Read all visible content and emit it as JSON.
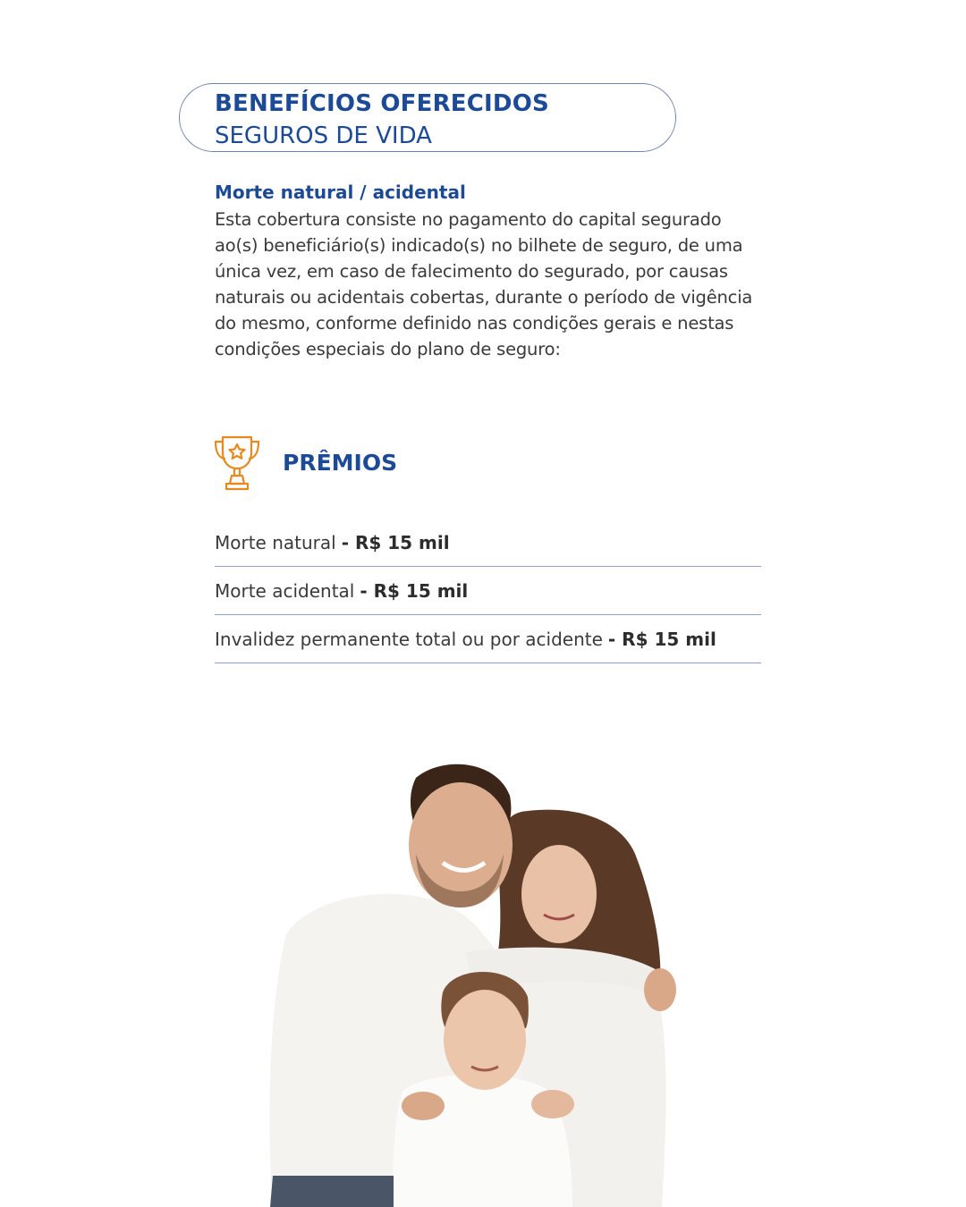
{
  "header": {
    "title": "BENEFÍCIOS OFERECIDOS",
    "subtitle": "SEGUROS DE VIDA"
  },
  "coverage": {
    "title": "Morte natural / acidental",
    "text": "Esta cobertura consiste no pagamento do capital segurado ao(s) beneficiário(s) indicado(s) no bilhete de seguro, de uma única vez, em caso de falecimento do segurado, por causas naturais ou acidentais cobertas, durante o período de vigência do mesmo, conforme definido nas condições gerais e nestas condições especiais do plano de seguro:"
  },
  "premios": {
    "title": "PRÊMIOS",
    "icon": "trophy-icon",
    "items": [
      {
        "label": "Morte natural",
        "value": "- R$ 15 mil"
      },
      {
        "label": "Morte acidental",
        "value": "- R$ 15 mil"
      },
      {
        "label": "Invalidez permanente total ou por acidente",
        "value": "- R$ 15 mil"
      }
    ]
  },
  "colors": {
    "brand_blue": "#1c4a96",
    "icon_orange": "#e8891f",
    "divider": "#8ea0c4",
    "text": "#3a3a3a"
  }
}
